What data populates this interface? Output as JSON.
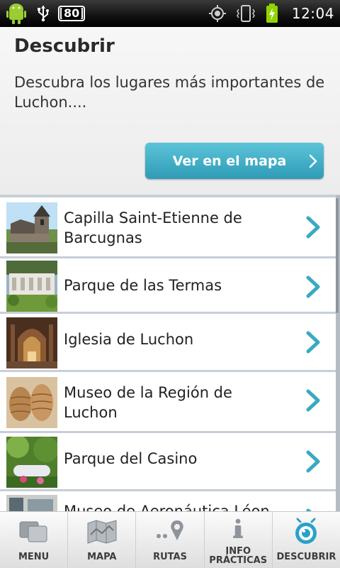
{
  "status_bar": {
    "battery_level": "80",
    "time": "12:04"
  },
  "header": {
    "title": "Descubrir",
    "description": "Descubra los lugares más importantes de Luchon....",
    "map_button_label": "Ver en el mapa"
  },
  "list": {
    "items": [
      {
        "title": "Capilla Saint-Etienne de Barcugnas"
      },
      {
        "title": "Parque de las Termas"
      },
      {
        "title": "Iglesia de Luchon"
      },
      {
        "title": "Museo de la Región de Luchon"
      },
      {
        "title": "Parque del Casino"
      },
      {
        "title": "Museo de Aeronáutica Léon"
      }
    ]
  },
  "tabs": [
    {
      "label": "MENU",
      "icon": "menu-icon"
    },
    {
      "label": "MAPA",
      "icon": "map-icon"
    },
    {
      "label": "RUTAS",
      "icon": "routes-icon"
    },
    {
      "label": "INFO\nPRÁCTICAS",
      "icon": "info-icon"
    },
    {
      "label": "DESCUBRIR",
      "icon": "discover-icon"
    }
  ],
  "colors": {
    "accent": "#2f9bb6",
    "accent_light": "#5cc4d8",
    "discover_active": "#2aa2c8"
  }
}
